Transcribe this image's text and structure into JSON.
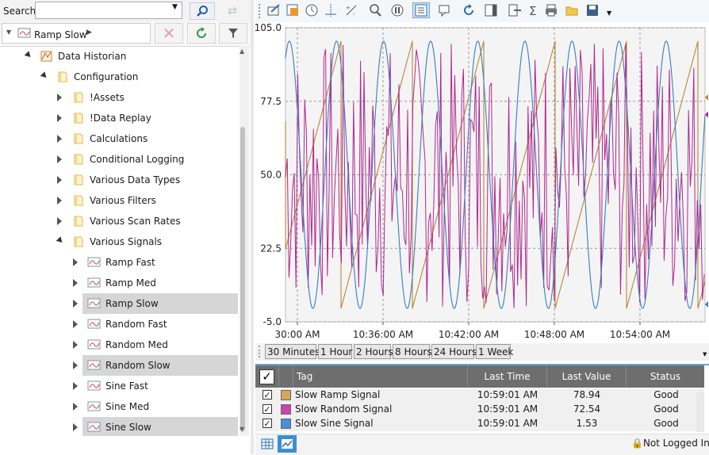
{
  "search": {
    "label": "Search:",
    "value": ""
  },
  "breadcrumb": {
    "label": "Ramp Slow"
  },
  "tree": {
    "items": [
      {
        "label": "Data Historian",
        "level": 1,
        "state": "open",
        "icon": "historian-icon",
        "selected": false
      },
      {
        "label": "Configuration",
        "level": 2,
        "state": "open",
        "icon": "folder-icon",
        "selected": false
      },
      {
        "label": "!Assets",
        "level": 3,
        "state": "closed",
        "icon": "folder-icon",
        "selected": false
      },
      {
        "label": "!Data Replay",
        "level": 3,
        "state": "closed",
        "icon": "folder-icon",
        "selected": false
      },
      {
        "label": "Calculations",
        "level": 3,
        "state": "closed",
        "icon": "folder-icon",
        "selected": false
      },
      {
        "label": "Conditional Logging",
        "level": 3,
        "state": "closed",
        "icon": "folder-icon",
        "selected": false
      },
      {
        "label": "Various Data Types",
        "level": 3,
        "state": "closed",
        "icon": "folder-icon",
        "selected": false
      },
      {
        "label": "Various Filters",
        "level": 3,
        "state": "closed",
        "icon": "folder-icon",
        "selected": false
      },
      {
        "label": "Various Scan Rates",
        "level": 3,
        "state": "closed",
        "icon": "folder-icon",
        "selected": false
      },
      {
        "label": "Various Signals",
        "level": 3,
        "state": "open",
        "icon": "folder-icon",
        "selected": false
      },
      {
        "label": "Ramp Fast",
        "level": 4,
        "state": "closed",
        "icon": "signal-icon",
        "selected": false
      },
      {
        "label": "Ramp Med",
        "level": 4,
        "state": "closed",
        "icon": "signal-icon",
        "selected": false
      },
      {
        "label": "Ramp Slow",
        "level": 4,
        "state": "closed",
        "icon": "signal-icon",
        "selected": true
      },
      {
        "label": "Random Fast",
        "level": 4,
        "state": "closed",
        "icon": "signal-icon",
        "selected": false
      },
      {
        "label": "Random Med",
        "level": 4,
        "state": "closed",
        "icon": "signal-icon",
        "selected": false
      },
      {
        "label": "Random Slow",
        "level": 4,
        "state": "closed",
        "icon": "signal-icon",
        "selected": true
      },
      {
        "label": "Sine Fast",
        "level": 4,
        "state": "closed",
        "icon": "signal-icon",
        "selected": false
      },
      {
        "label": "Sine Med",
        "level": 4,
        "state": "closed",
        "icon": "signal-icon",
        "selected": false
      },
      {
        "label": "Sine Slow",
        "level": 4,
        "state": "closed",
        "icon": "signal-icon",
        "selected": true
      }
    ]
  },
  "toolbar": {
    "icons": [
      "edit-icon",
      "add-pen-icon",
      "clock-icon",
      "cursor-icon",
      "scale-icon",
      "zoom-icon",
      "pause-icon",
      "legend-icon",
      "comment-icon",
      "refresh-icon",
      "panel-icon",
      "export-icon",
      "sum-icon",
      "print-icon",
      "open-icon",
      "save-icon"
    ]
  },
  "time_ranges": [
    "30 Minutes",
    "1 Hour",
    "2 Hours",
    "8 Hours",
    "24 Hours",
    "1 Week"
  ],
  "grid": {
    "headers": {
      "tag": "Tag",
      "last_time": "Last Time",
      "last_value": "Last Value",
      "status": "Status"
    },
    "rows": [
      {
        "tag": "Slow Ramp Signal",
        "last_time": "10:59:01 AM",
        "last_value": "78.94",
        "status": "Good",
        "color": "#d9a55b",
        "checked": true
      },
      {
        "tag": "Slow Random Signal",
        "last_time": "10:59:01 AM",
        "last_value": "72.54",
        "status": "Good",
        "color": "#cc44b0",
        "checked": true
      },
      {
        "tag": "Slow Sine Signal",
        "last_time": "10:59:01 AM",
        "last_value": "1.53",
        "status": "Good",
        "color": "#4a8fd8",
        "checked": true
      }
    ]
  },
  "status": {
    "login": "Not Logged In"
  },
  "chart_data": {
    "type": "line",
    "y_ticks": [
      "105.0",
      "77.5",
      "50.0",
      "22.5",
      "-5.0"
    ],
    "ylim": [
      -5.0,
      105.0
    ],
    "x_ticks": [
      "30:00 AM",
      "10:36:00 AM",
      "10:42:00 AM",
      "10:48:00 AM",
      "10:54:00 AM"
    ],
    "grid": true,
    "series": [
      {
        "name": "Slow Ramp Signal",
        "color": "#b8883a",
        "pattern": "sawtooth",
        "min": 0,
        "max": 100,
        "period_minutes": 5,
        "last": 78.94
      },
      {
        "name": "Slow Random Signal",
        "color": "#b0288f",
        "pattern": "random",
        "min": 0,
        "max": 100,
        "last": 72.54
      },
      {
        "name": "Slow Sine Signal",
        "color": "#3a7dbf",
        "pattern": "sine",
        "min": 0,
        "max": 100,
        "period_minutes": 3.3,
        "last": 1.53
      }
    ]
  }
}
